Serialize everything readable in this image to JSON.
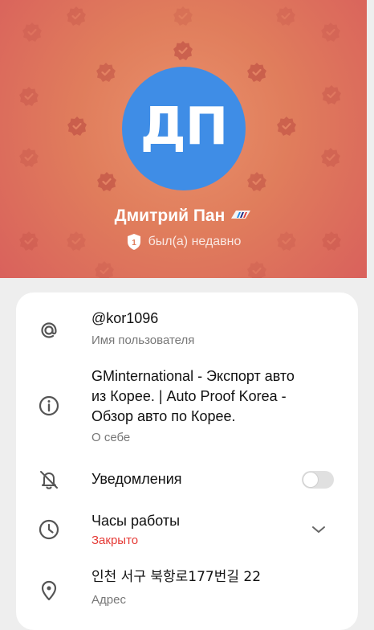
{
  "profile": {
    "avatar_initials": "ДП",
    "name": "Дмитрий Пан",
    "name_emoji": "bmw-m-flag-emoji",
    "status_badge": "1",
    "status": "был(а) недавно",
    "header_colors": [
      "#e9906a",
      "#d9615c"
    ],
    "avatar_color": "#3f8de6"
  },
  "info": {
    "username": {
      "value": "@kor1096",
      "label": "Имя пользователя",
      "icon": "at-icon"
    },
    "bio": {
      "lines": [
        "GMinternational - Экспорт авто",
        "из Корее. | Auto Proof Korea -",
        "Обзор авто по Корее."
      ],
      "label": "О себе",
      "icon": "info-icon"
    },
    "notifications": {
      "label": "Уведомления",
      "icon": "bell-off-icon",
      "enabled": false
    },
    "hours": {
      "label": "Часы работы",
      "value": "Закрыто",
      "icon": "clock-icon",
      "value_color": "#e53935"
    },
    "address": {
      "value": "인천 서구 북항로177번길 22",
      "label": "Адрес",
      "icon": "location-pin-icon"
    }
  }
}
